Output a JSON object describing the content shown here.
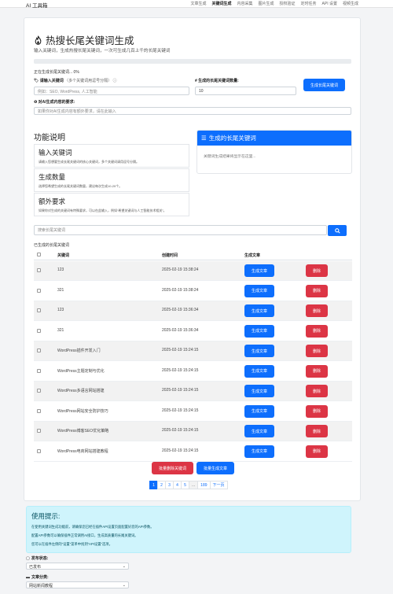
{
  "nav": {
    "brand": "AI 工具箱",
    "links": [
      "文章生成",
      "关键词生成",
      "内容采集",
      "图片生成",
      "授权验证",
      "定时任务",
      "API 设置",
      "视频生成"
    ],
    "active_index": 1
  },
  "header": {
    "title": "热搜长尾关键词生成",
    "description": "输入关键词，生成热搜长尾关键词，一次可生成几百上千的长尾关键词"
  },
  "progress": {
    "value": 0,
    "text": "正在生成长尾关键词... 0%"
  },
  "form": {
    "keywords_label": "请输入关键词",
    "keywords_hint": "（多个关键词用逗号分隔）",
    "keywords_placeholder": "例如：SEO, WordPress, 人工智能",
    "count_label": "生成的长尾关键词数量:",
    "count_value": "10",
    "generate_button": "生成长尾关键词",
    "requirements_label": "对AI生成内容的要求:",
    "requirements_placeholder": "如果你对AI生成内容有额外要求，请在此输入"
  },
  "help": {
    "title": "功能说明",
    "items": [
      {
        "title": "输入关键词",
        "desc": "请输入您想要生成长尾关键词的核心关键词，多个关键词请用逗号分隔。"
      },
      {
        "title": "生成数量",
        "desc": "选择您希望生成的长尾关键词数量，建议每次生成10-20个。"
      },
      {
        "title": "额外要求",
        "desc": "如果你对生成的关键词有特殊要求，可以在此输入，例如“希望关键词与人工智能技术相关”。"
      }
    ]
  },
  "generated": {
    "title": "生成的长尾关键词",
    "empty_text": "关键词生成结果将显示在这里..."
  },
  "search": {
    "placeholder": "搜索长尾关键词"
  },
  "table": {
    "title": "已生成的长尾关键词",
    "headers": [
      "关键词",
      "创建时间",
      "生成文章"
    ],
    "gen_label": "生成文章",
    "del_label": "删除",
    "rows": [
      {
        "keyword": "123",
        "time": "2025-02-19 15:38:24"
      },
      {
        "keyword": "321",
        "time": "2025-02-19 15:38:24"
      },
      {
        "keyword": "123",
        "time": "2025-02-19 15:36:34"
      },
      {
        "keyword": "321",
        "time": "2025-02-19 15:36:34"
      },
      {
        "keyword": "WordPress插件开发入门",
        "time": "2025-02-19 15:24:15"
      },
      {
        "keyword": "WordPress主题定制与优化",
        "time": "2025-02-19 15:24:15"
      },
      {
        "keyword": "WordPress多语言网站搭建",
        "time": "2025-02-19 15:24:15"
      },
      {
        "keyword": "WordPress网站安全防护技巧",
        "time": "2025-02-19 15:24:15"
      },
      {
        "keyword": "WordPress博客SEO优化策略",
        "time": "2025-02-19 15:24:15"
      },
      {
        "keyword": "WordPress电商网站搭建教程",
        "time": "2025-02-19 15:24:15"
      }
    ]
  },
  "bulk": {
    "delete_label": "批量删除关键词",
    "generate_label": "批量生成文章"
  },
  "pagination": {
    "pages": [
      "1",
      "2",
      "3",
      "4",
      "5",
      "...",
      "189",
      "下一页"
    ],
    "active": "1"
  },
  "tips": {
    "title": "使用提示:",
    "lines": [
      "在使用关键词生成功能前，请确保您已经在插件API设置页面配置好您的API参数。",
      "配置API参数可以确保插件正常调用AI接口，生成高质量的长尾关键词。",
      "您可以在插件左侧的“设置”菜单中找到“API设置”选项。"
    ]
  },
  "status": {
    "label": "发布状态:",
    "value": "已发布"
  },
  "category": {
    "label": "文章分类:",
    "value": "网站新闻教程"
  },
  "colors": {
    "primary": "#0d6efd",
    "danger": "#dc3545",
    "info_bg": "#cff4fc",
    "flame": "#e8590c"
  }
}
